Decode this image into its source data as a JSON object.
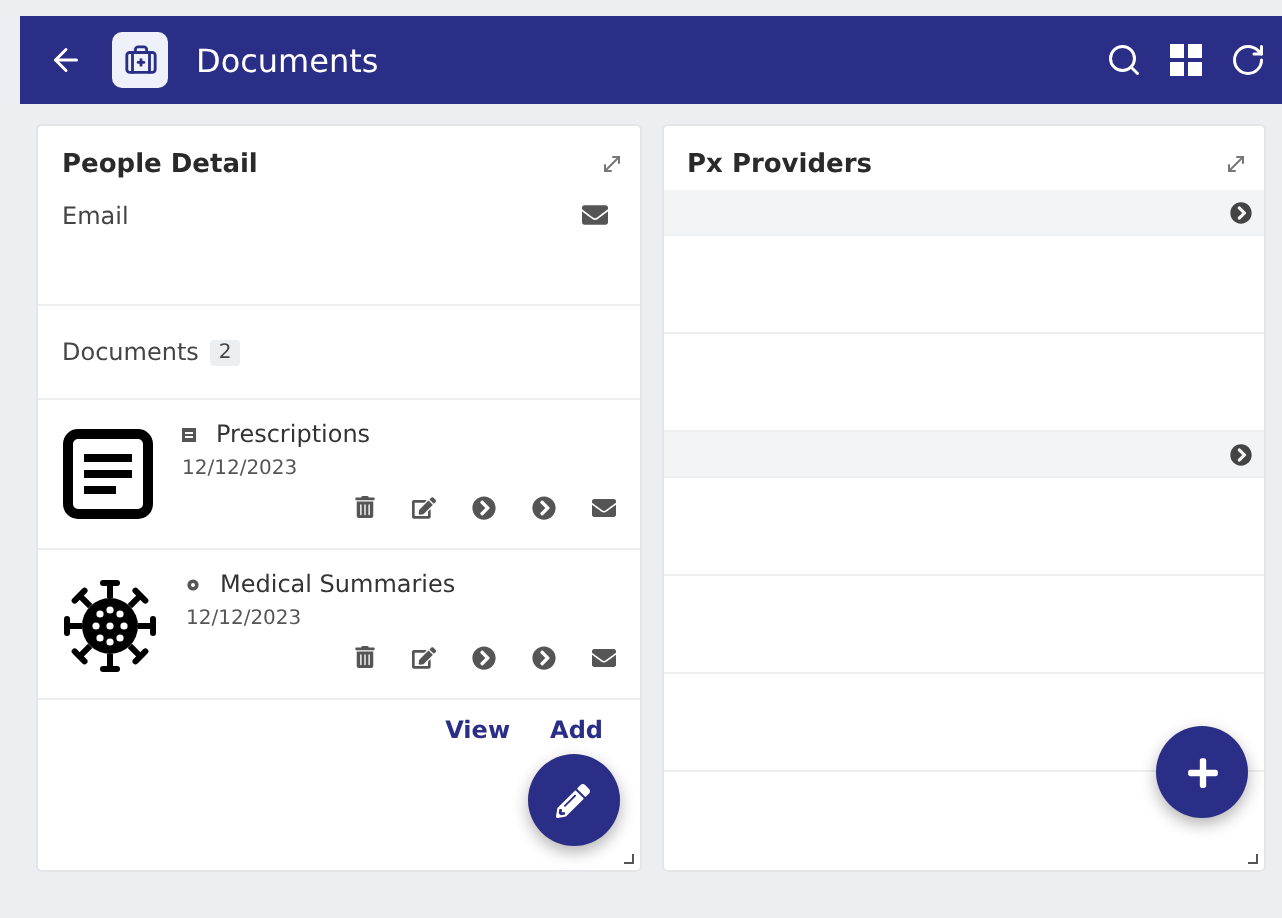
{
  "header": {
    "title": "Documents"
  },
  "people_detail": {
    "title": "People Detail",
    "email_label": "Email",
    "documents_label": "Documents",
    "documents_count": "2",
    "documents": [
      {
        "kind": "document",
        "name": "Prescriptions",
        "date": "12/12/2023"
      },
      {
        "kind": "virus",
        "name": "Medical Summaries",
        "date": "12/12/2023"
      }
    ],
    "links": [
      "View",
      "Add"
    ]
  },
  "providers": {
    "title": "Px Providers",
    "rows": [
      {
        "kind": "group"
      },
      {
        "kind": "empty"
      },
      {
        "kind": "empty"
      },
      {
        "kind": "group"
      },
      {
        "kind": "empty"
      },
      {
        "kind": "empty"
      },
      {
        "kind": "empty"
      }
    ]
  }
}
